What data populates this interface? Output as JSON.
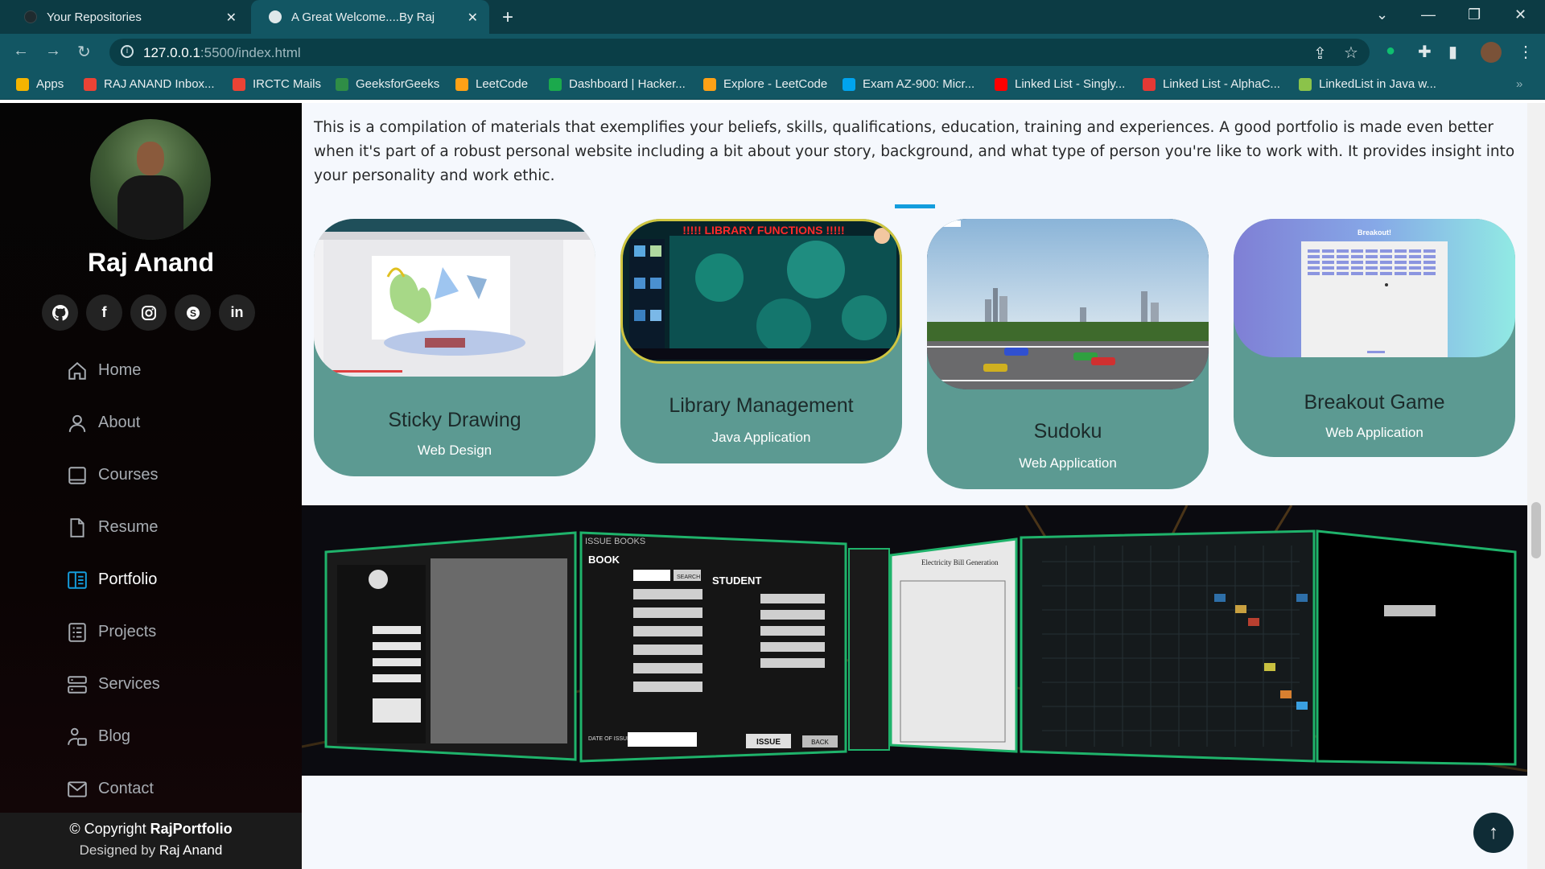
{
  "browser": {
    "tabs": [
      {
        "title": "Your Repositories",
        "active": false
      },
      {
        "title": "A Great Welcome....By Raj",
        "active": true
      }
    ],
    "new_tab_icon": "plus-icon",
    "url_host": "127.0.0.1",
    "url_path": ":5500/index.html",
    "bookmarks": [
      {
        "label": "Apps",
        "color": "#f4b400"
      },
      {
        "label": "RAJ ANAND Inbox...",
        "color": "#ea4335"
      },
      {
        "label": "IRCTC Mails",
        "color": "#ea4335"
      },
      {
        "label": "GeeksforGeeks",
        "color": "#2f8d46"
      },
      {
        "label": "LeetCode",
        "color": "#ffa116"
      },
      {
        "label": "Dashboard | Hacker...",
        "color": "#1ba94c"
      },
      {
        "label": "Explore - LeetCode",
        "color": "#ffa116"
      },
      {
        "label": "Exam AZ-900: Micr...",
        "color": "#00a4ef"
      },
      {
        "label": "Linked List - Singly...",
        "color": "#ff0000"
      },
      {
        "label": "Linked List - AlphaC...",
        "color": "#e53935"
      },
      {
        "label": "LinkedList in Java w...",
        "color": "#8bc34a"
      }
    ]
  },
  "sidebar": {
    "name": "Raj Anand",
    "socials": [
      {
        "icon": "github-icon",
        "glyph": "◉"
      },
      {
        "icon": "facebook-icon",
        "glyph": "f"
      },
      {
        "icon": "instagram-icon",
        "glyph": "◎"
      },
      {
        "icon": "skype-icon",
        "glyph": "S"
      },
      {
        "icon": "linkedin-icon",
        "glyph": "in"
      }
    ],
    "menu": [
      {
        "label": "Home",
        "icon": "home-icon",
        "active": false
      },
      {
        "label": "About",
        "icon": "person-icon",
        "active": false
      },
      {
        "label": "Courses",
        "icon": "book-icon",
        "active": false
      },
      {
        "label": "Resume",
        "icon": "file-icon",
        "active": false
      },
      {
        "label": "Portfolio",
        "icon": "portfolio-icon",
        "active": true
      },
      {
        "label": "Projects",
        "icon": "list-icon",
        "active": false
      },
      {
        "label": "Services",
        "icon": "server-icon",
        "active": false
      },
      {
        "label": "Blog",
        "icon": "blog-icon",
        "active": false
      },
      {
        "label": "Contact",
        "icon": "envelope-icon",
        "active": false
      }
    ],
    "copyright_prefix": "© Copyright",
    "copyright_brand": "RajPortfolio",
    "designed_prefix": "Designed by",
    "designed_by": "Raj Anand"
  },
  "main": {
    "intro": "This is a compilation of materials that exemplifies your beliefs, skills, qualifications, education, training and experiences. A good portfolio is made even better when it's part of a robust personal website including a bit about your story, background, and what type of person you're like to work with. It provides insight into your personality and work ethic.",
    "cards": [
      {
        "title": "Sticky Drawing",
        "subtitle": "Web Design"
      },
      {
        "title": "Library Management",
        "subtitle": "Java Application",
        "image_text": "!!!!! LIBRARY FUNCTIONS !!!!!"
      },
      {
        "title": "Sudoku",
        "subtitle": "Web Application"
      },
      {
        "title": "Breakout Game",
        "subtitle": "Web Application",
        "image_text": "Breakout!"
      }
    ],
    "carousel": {
      "panel_book": {
        "header": "ISSUE BOOKS",
        "book_heading": "BOOK",
        "student_heading": "STUDENT",
        "issue_button": "ISSUE",
        "back_button": "BACK",
        "date_label": "DATE OF ISSUE",
        "search_label": "SEARCH"
      },
      "panel_bill": {
        "header": "Electricity Bill Generation"
      }
    }
  },
  "accent": "#149ddd",
  "card_color": "#5c9a92"
}
